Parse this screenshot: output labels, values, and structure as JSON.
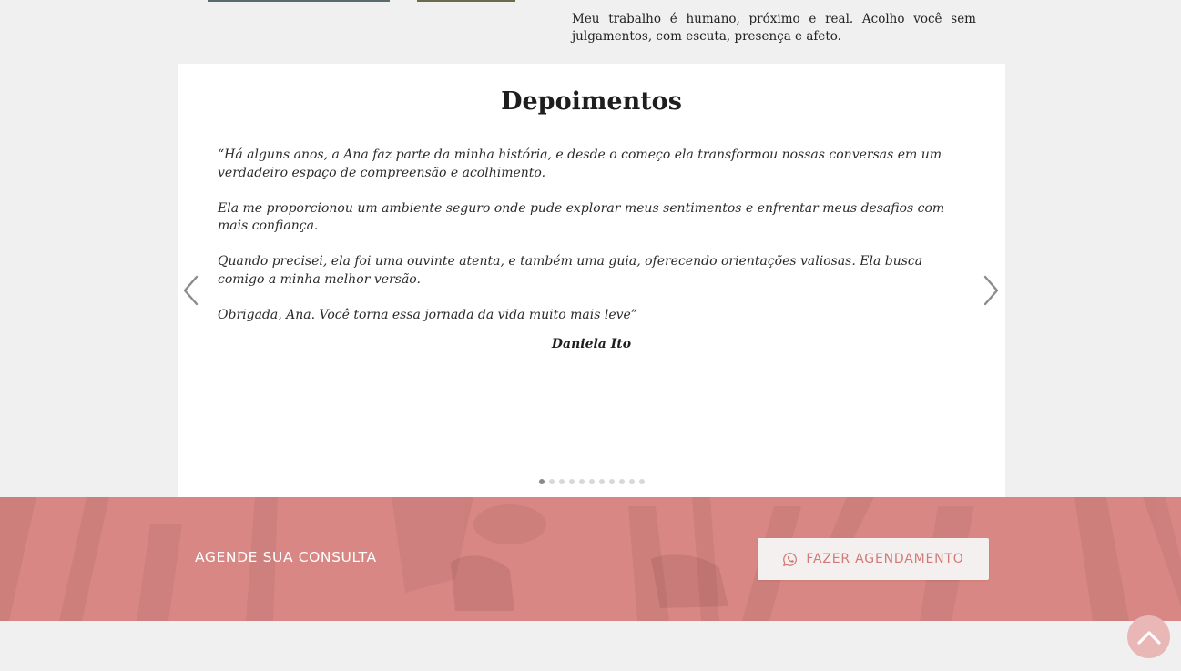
{
  "about": {
    "text": "Meu trabalho é humano, próximo e real. Acolho você sem julgamentos, com escuta, presença e afeto."
  },
  "testimonials": {
    "title": "Depoimentos",
    "current": {
      "paragraphs": [
        "“Há alguns anos, a Ana faz parte da minha história, e desde o começo ela transformou nossas conversas em um verdadeiro espaço de compreensão e acolhimento.",
        "Ela me proporcionou um ambiente seguro onde pude explorar meus sentimentos e enfrentar meus desafios com mais confiança.",
        "Quando precisei, ela foi uma ouvinte atenta, e também uma guia, oferecendo orientações valiosas. Ela busca comigo a minha melhor versão.",
        "Obrigada, Ana. Você torna essa jornada da vida muito mais leve”"
      ],
      "author": "Daniela Ito"
    },
    "prev_icon": "chevron-left-icon",
    "next_icon": "chevron-right-icon",
    "dots_total": 11,
    "active_dot": 0
  },
  "cta": {
    "label": "AGENDE SUA CONSULTA",
    "button_label": "FAZER AGENDAMENTO",
    "button_icon": "whatsapp-icon"
  },
  "scroll_top_icon": "chevron-up-icon",
  "colors": {
    "page_bg": "#f0f0f0",
    "cta_bg": "#d98784",
    "button_text": "#d27a77",
    "scroll_top_bg": "#e9b7b5"
  }
}
